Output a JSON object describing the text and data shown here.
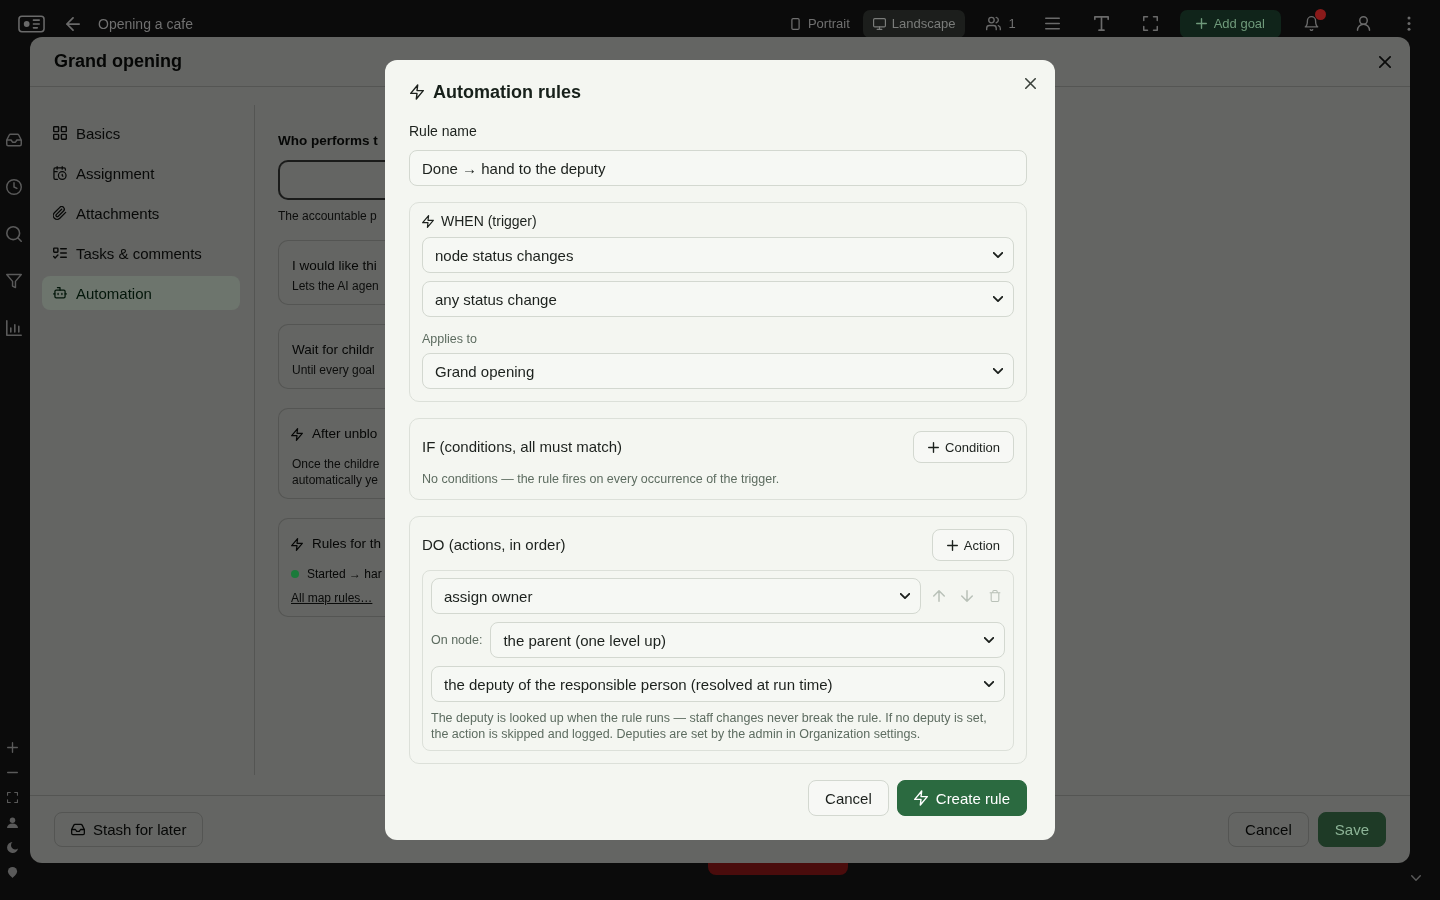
{
  "app_bar": {
    "title": "Opening a cafe",
    "view_modes": [
      {
        "label": "Portrait",
        "selected": false
      },
      {
        "label": "Landscape",
        "selected": true
      }
    ],
    "member_count": "1",
    "add_button": "Add goal"
  },
  "dialog": {
    "title": "Grand opening",
    "nav": [
      {
        "label": "Basics",
        "selected": false
      },
      {
        "label": "Assignment",
        "selected": false
      },
      {
        "label": "Attachments",
        "selected": false
      },
      {
        "label": "Tasks & comments",
        "selected": false
      },
      {
        "label": "Automation",
        "selected": true
      }
    ],
    "content": {
      "field_label": "Who performs t",
      "field_hint": "The accountable p",
      "cards": [
        {
          "kind": "option",
          "title": "I would like thi",
          "lines": [
            "Lets the AI agen"
          ]
        },
        {
          "kind": "option",
          "title": "Wait for childr",
          "lines": [
            "Until every goal"
          ]
        },
        {
          "kind": "automation",
          "title": "After unblo",
          "lines": [
            "Once the childre",
            "automatically ye"
          ]
        },
        {
          "kind": "rules",
          "title": "Rules for th",
          "rules": [
            {
              "label": "Started → har",
              "color": "#1b7a3a"
            }
          ],
          "link": "All map rules…"
        }
      ]
    },
    "footer": {
      "stash_button": "Stash for later",
      "cancel_button": "Cancel",
      "save_button": "Save"
    }
  },
  "modal": {
    "title": "Automation rules",
    "rule_name": {
      "label": "Rule name",
      "value": "Done → hand to the deputy"
    },
    "when": {
      "heading": "WHEN (trigger)",
      "trigger": "node status changes",
      "status": "any status change",
      "applies_to": {
        "label": "Applies to",
        "value": "Grand opening"
      }
    },
    "if": {
      "heading": "IF (conditions, all must match)",
      "add_button": "Condition",
      "empty_text": "No conditions — the rule fires on every occurrence of the trigger."
    },
    "do": {
      "heading": "DO (actions, in order)",
      "add_button": "Action",
      "actions": [
        {
          "type": "assign owner",
          "controls": [
            {
              "kind": "move_up",
              "disabled": true
            },
            {
              "kind": "move_down",
              "disabled": true
            },
            {
              "kind": "delete",
              "disabled": true
            }
          ],
          "node_label": "On node:",
          "node": "the parent (one level up)",
          "assignee": "the deputy of the responsible person (resolved at run time)",
          "note": "The deputy is looked up when the rule runs — staff changes never break the rule. If no deputy is set, the action is skipped and logged. Deputies are set by the admin in Organization settings."
        }
      ]
    },
    "buttons": {
      "cancel": "Cancel",
      "create": "Create rule"
    }
  }
}
